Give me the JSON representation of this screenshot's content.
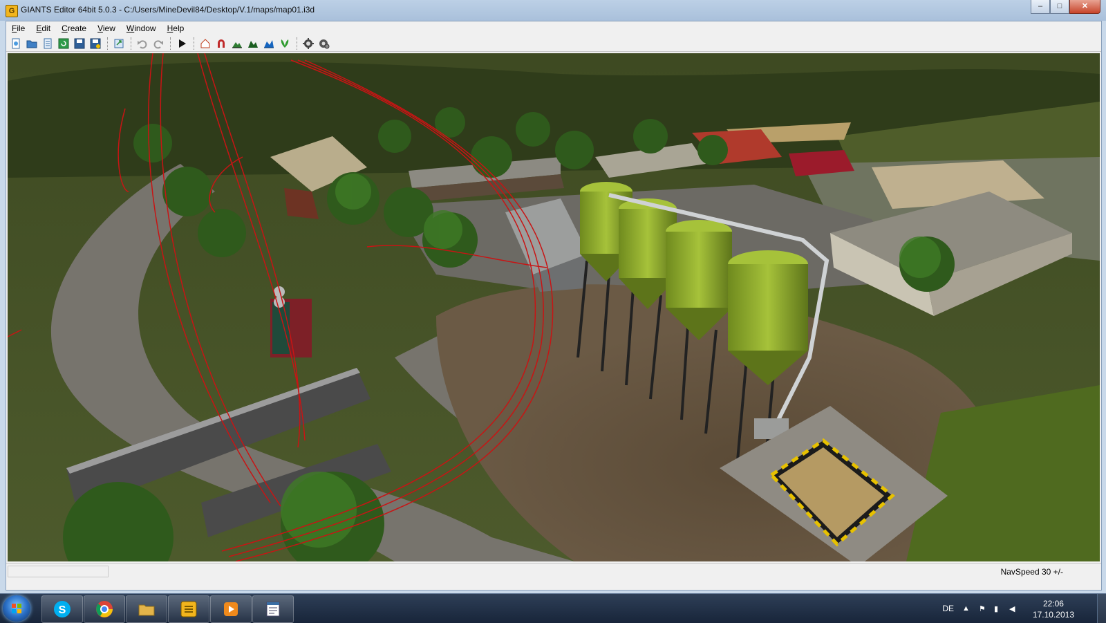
{
  "window": {
    "title": "GIANTS Editor 64bit 5.0.3 - C:/Users/MineDevil84/Desktop/V.1/maps/map01.i3d",
    "app_icon_letter": "G",
    "minimize": "–",
    "maximize": "□",
    "close": "✕"
  },
  "menu": {
    "items": [
      "File",
      "Edit",
      "Create",
      "View",
      "Window",
      "Help"
    ]
  },
  "toolbar": {
    "buttons": [
      "new-file",
      "open-file",
      "save-list",
      "reload",
      "save",
      "save-as",
      "export",
      "undo",
      "redo",
      "play",
      "home",
      "magnet",
      "terrain-edit-1",
      "terrain-edit-2",
      "terrain-edit-3",
      "foliage",
      "transform-settings",
      "scene-settings"
    ]
  },
  "statusbar": {
    "navspeed": "NavSpeed 30 +/-"
  },
  "taskbar": {
    "apps": [
      "skype",
      "chrome",
      "explorer",
      "giants-editor",
      "media-player",
      "notepad"
    ],
    "language": "DE",
    "time": "22:06",
    "date": "17.10.2013"
  },
  "colors": {
    "silo_green": "#8faa2c",
    "spline_red": "#c81414",
    "grass": "#4e5f26",
    "gravel": "#7b7770"
  }
}
